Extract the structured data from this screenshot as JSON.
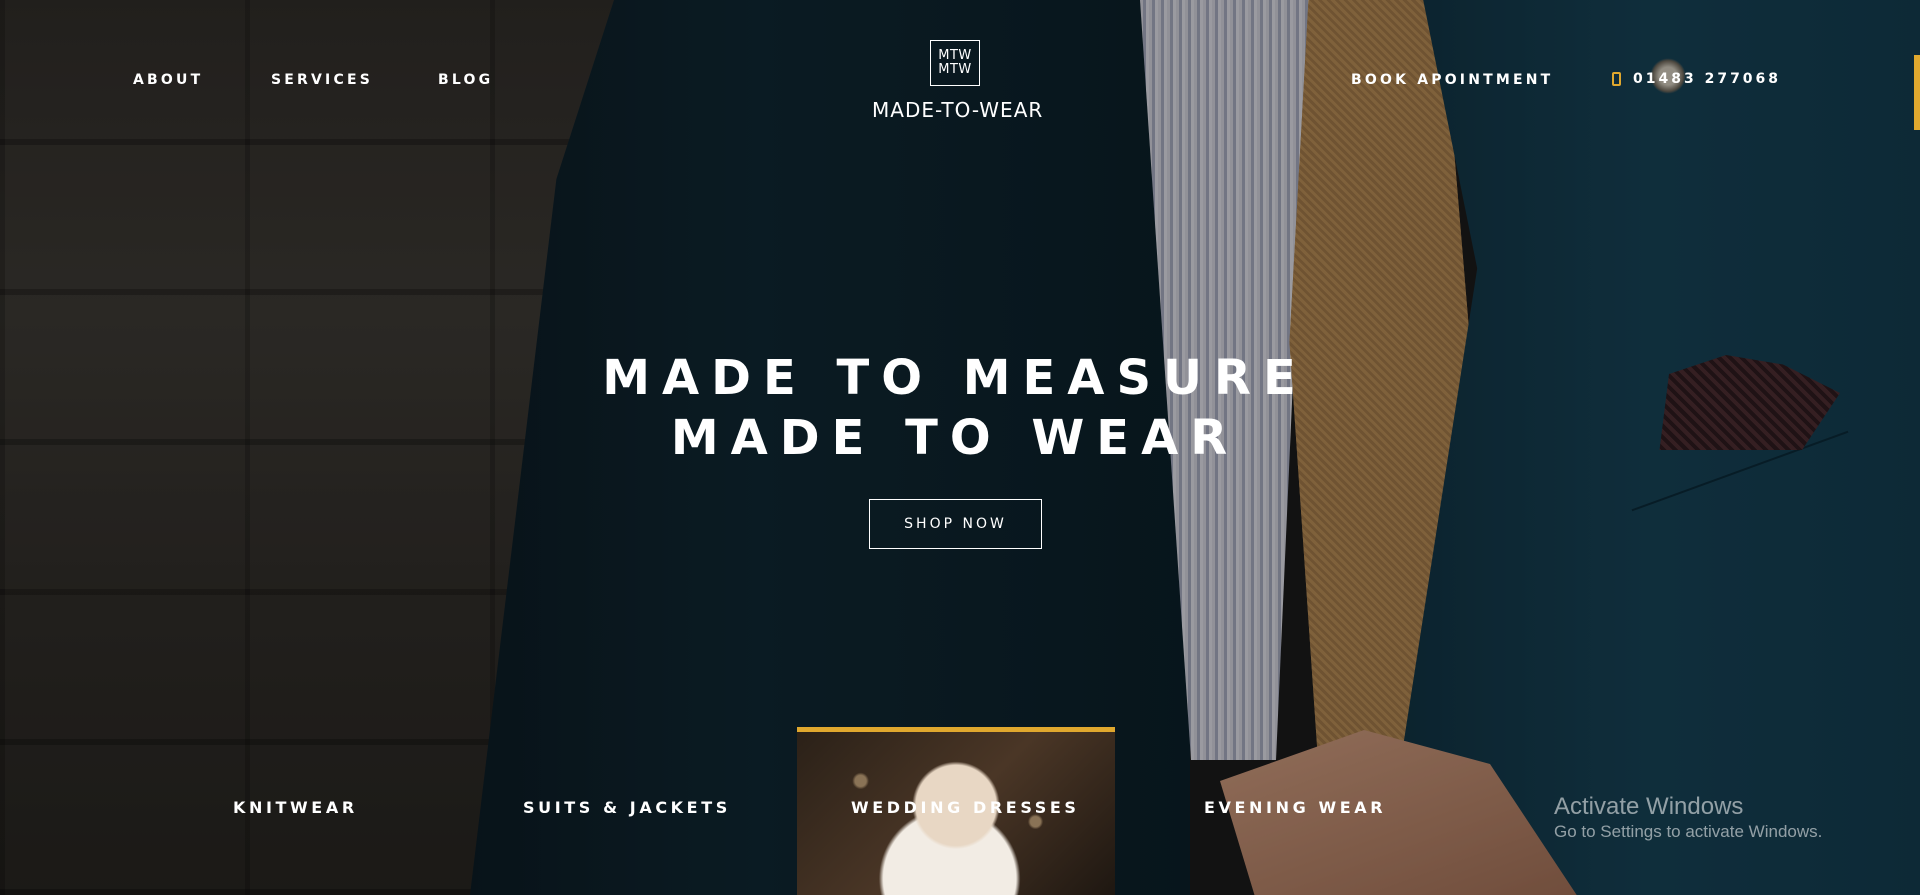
{
  "nav": {
    "items": [
      {
        "label": "ABOUT"
      },
      {
        "label": "SERVICES"
      },
      {
        "label": "BLOG"
      }
    ],
    "book_label": "BOOK APOINTMENT",
    "phone": "01483 277068"
  },
  "logo": {
    "mark_top": "MTW",
    "mark_bottom": "MTW",
    "name": "MADE-TO-WEAR"
  },
  "hero": {
    "line1": "MADE TO MEASURE",
    "line2": "MADE TO WEAR",
    "cta": "SHOP NOW"
  },
  "categories": [
    {
      "label": "KNITWEAR"
    },
    {
      "label": "SUITS & JACKETS"
    },
    {
      "label": "WEDDING DRESSES",
      "active": true
    },
    {
      "label": "EVENING WEAR"
    }
  ],
  "watermark": {
    "title": "Activate Windows",
    "subtitle": "Go to Settings to activate Windows."
  },
  "colors": {
    "accent": "#e0a82e"
  }
}
